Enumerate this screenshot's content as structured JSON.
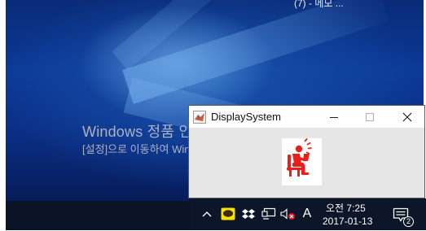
{
  "desktop": {
    "top_label": "(7) - 메모 ...",
    "activation_title": "Windows 정품 인증",
    "activation_subtitle": "[설정]으로 이동하여 Windows 정품 인증"
  },
  "popup": {
    "title": "DisplaySystem",
    "minimize_label": "—",
    "maximize_label": "☐",
    "close_label": "✕",
    "content_icon": "sitting-person-icon",
    "accent_color": "#e8201c"
  },
  "taskbar": {
    "tray_icons": [
      "chevron-up-icon",
      "chat-bubble-icon",
      "dropbox-icon",
      "network-icon",
      "volume-muted-icon",
      "ime-icon"
    ],
    "ime_label": "A",
    "clock_time": "오전 7:25",
    "clock_date": "2017-01-13",
    "notification_count": "2"
  }
}
